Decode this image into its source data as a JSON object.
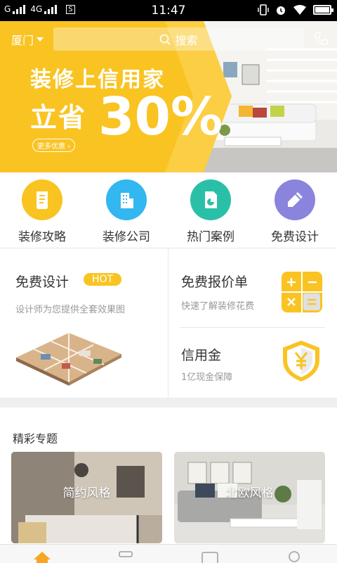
{
  "status_bar": {
    "carrier_left": "G",
    "network": "4G",
    "sim_label": "S",
    "time": "11:47"
  },
  "header": {
    "city": "厦门",
    "search_placeholder": "搜索"
  },
  "banner": {
    "line1": "装修上信用家",
    "line2_prefix": "立省",
    "discount": "30%",
    "more_button": "更多优惠"
  },
  "categories": [
    {
      "label": "装修攻略",
      "color": "#f9c322",
      "icon": "guide-icon"
    },
    {
      "label": "装修公司",
      "color": "#32b7f0",
      "icon": "company-icon"
    },
    {
      "label": "热门案例",
      "color": "#2ac0a7",
      "icon": "case-icon"
    },
    {
      "label": "免费设计",
      "color": "#8a84dd",
      "icon": "pencil-icon"
    }
  ],
  "features": {
    "design": {
      "title": "免费设计",
      "badge": "HOT",
      "subtitle": "设计师为您提供全套效果图"
    },
    "quote": {
      "title": "免费报价单",
      "subtitle": "快速了解装修花费"
    },
    "credit": {
      "title": "信用金",
      "subtitle": "1亿现金保障"
    }
  },
  "topics": {
    "title": "精彩专题",
    "items": [
      {
        "label": "简约风格"
      },
      {
        "label": "北欧风格"
      }
    ]
  },
  "accent_color": "#f9c322"
}
